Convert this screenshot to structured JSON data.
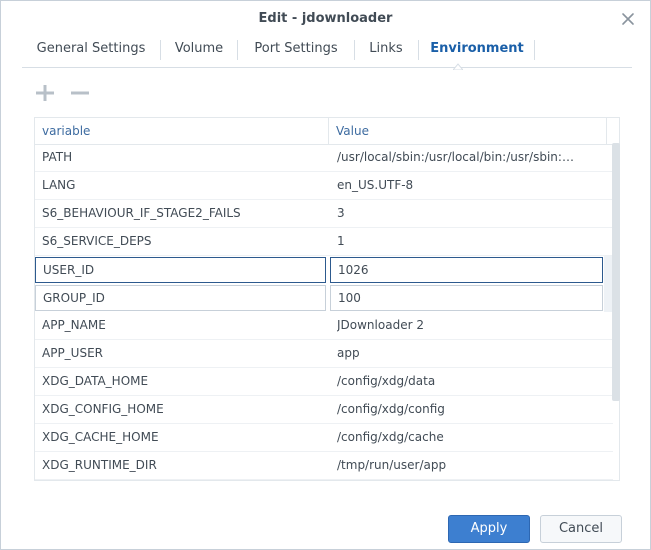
{
  "window": {
    "title": "Edit - jdownloader"
  },
  "tabs": [
    {
      "label": "General Settings"
    },
    {
      "label": "Volume"
    },
    {
      "label": "Port Settings"
    },
    {
      "label": "Links"
    },
    {
      "label": "Environment",
      "active": true
    }
  ],
  "toolbar": {
    "add_icon": "plus-icon",
    "remove_icon": "minus-icon"
  },
  "grid": {
    "columns": [
      "variable",
      "Value"
    ],
    "rows": [
      {
        "variable": "PATH",
        "value": "/usr/local/sbin:/usr/local/bin:/usr/sbin:/usr/bin:/sbin:/bin"
      },
      {
        "variable": "LANG",
        "value": "en_US.UTF-8"
      },
      {
        "variable": "S6_BEHAVIOUR_IF_STAGE2_FAILS",
        "value": "3"
      },
      {
        "variable": "S6_SERVICE_DEPS",
        "value": "1"
      },
      {
        "variable": "USER_ID",
        "value": "1026",
        "editing": true
      },
      {
        "variable": "GROUP_ID",
        "value": "100",
        "editing": true
      },
      {
        "variable": "APP_NAME",
        "value": "JDownloader 2"
      },
      {
        "variable": "APP_USER",
        "value": "app"
      },
      {
        "variable": "XDG_DATA_HOME",
        "value": "/config/xdg/data"
      },
      {
        "variable": "XDG_CONFIG_HOME",
        "value": "/config/xdg/config"
      },
      {
        "variable": "XDG_CACHE_HOME",
        "value": "/config/xdg/cache"
      },
      {
        "variable": "XDG_RUNTIME_DIR",
        "value": "/tmp/run/user/app"
      }
    ]
  },
  "footer": {
    "apply_label": "Apply",
    "cancel_label": "Cancel"
  },
  "colors": {
    "accent": "#3d7fd0",
    "active_tab": "#1a5fa8",
    "header_text": "#3d6ba0"
  }
}
